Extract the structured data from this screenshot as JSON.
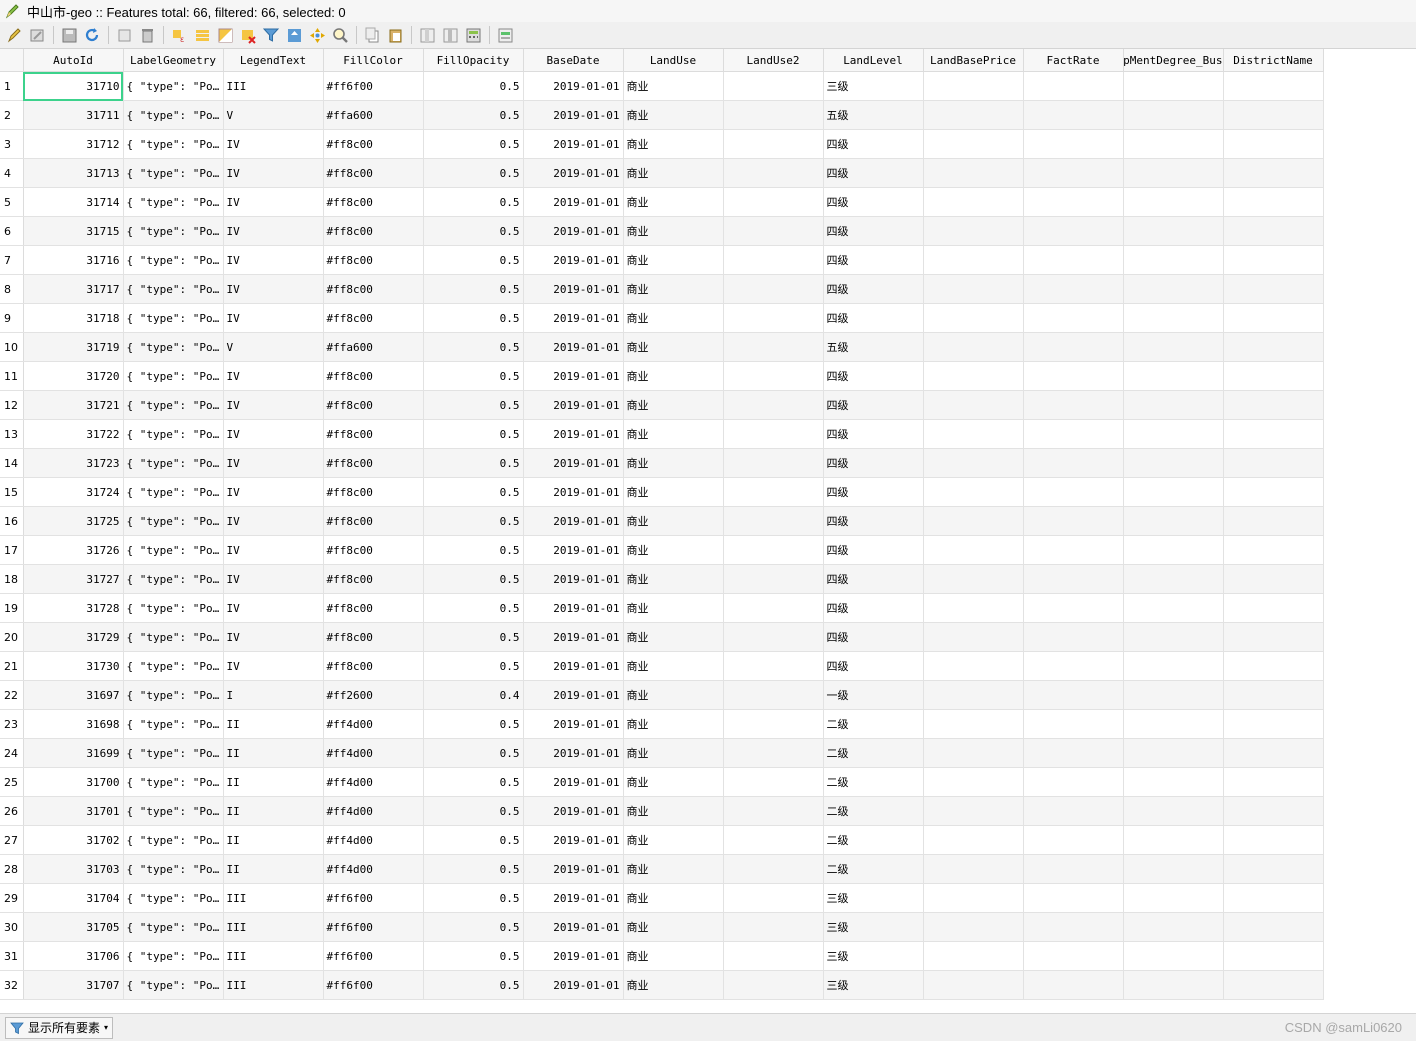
{
  "window": {
    "title": "中山市-geo :: Features total: 66, filtered: 66, selected: 0"
  },
  "toolbar": {
    "buttons": [
      {
        "icon": "toggle-editing-icon"
      },
      {
        "icon": "multi-edit-icon"
      },
      {
        "icon": "save-edits-icon"
      },
      {
        "icon": "reload-icon"
      },
      {
        "icon": "add-feature-icon"
      },
      {
        "icon": "delete-feature-icon"
      },
      {
        "icon": "select-by-expression-icon"
      },
      {
        "icon": "select-all-icon"
      },
      {
        "icon": "invert-selection-icon"
      },
      {
        "icon": "deselect-all-icon"
      },
      {
        "icon": "filter-icon"
      },
      {
        "icon": "move-selection-to-top-icon"
      },
      {
        "icon": "pan-to-selected-icon"
      },
      {
        "icon": "zoom-to-selected-icon"
      },
      {
        "icon": "copy-icon"
      },
      {
        "icon": "paste-icon"
      },
      {
        "icon": "new-field-icon"
      },
      {
        "icon": "delete-field-icon"
      },
      {
        "icon": "field-calculator-icon"
      },
      {
        "icon": "conditional-formatting-icon"
      }
    ]
  },
  "table": {
    "columns": [
      "AutoId",
      "LabelGeometry",
      "LegendText",
      "FillColor",
      "FillOpacity",
      "BaseDate",
      "LandUse",
      "LandUse2",
      "LandLevel",
      "LandBasePrice",
      "FactRate",
      "opMentDegree_Bus",
      "DistrictName"
    ],
    "rows": [
      {
        "n": "1",
        "id": "31710",
        "geom": "{ \"type\": \"Po…",
        "legend": "III",
        "color": "#ff6f00",
        "opacity": "0.5",
        "date": "2019-01-01",
        "use": "商业",
        "use2": "",
        "level": "三级"
      },
      {
        "n": "2",
        "id": "31711",
        "geom": "{ \"type\": \"Po…",
        "legend": "V",
        "color": "#ffa600",
        "opacity": "0.5",
        "date": "2019-01-01",
        "use": "商业",
        "use2": "",
        "level": "五级"
      },
      {
        "n": "3",
        "id": "31712",
        "geom": "{ \"type\": \"Po…",
        "legend": "IV",
        "color": "#ff8c00",
        "opacity": "0.5",
        "date": "2019-01-01",
        "use": "商业",
        "use2": "",
        "level": "四级"
      },
      {
        "n": "4",
        "id": "31713",
        "geom": "{ \"type\": \"Po…",
        "legend": "IV",
        "color": "#ff8c00",
        "opacity": "0.5",
        "date": "2019-01-01",
        "use": "商业",
        "use2": "",
        "level": "四级"
      },
      {
        "n": "5",
        "id": "31714",
        "geom": "{ \"type\": \"Po…",
        "legend": "IV",
        "color": "#ff8c00",
        "opacity": "0.5",
        "date": "2019-01-01",
        "use": "商业",
        "use2": "",
        "level": "四级"
      },
      {
        "n": "6",
        "id": "31715",
        "geom": "{ \"type\": \"Po…",
        "legend": "IV",
        "color": "#ff8c00",
        "opacity": "0.5",
        "date": "2019-01-01",
        "use": "商业",
        "use2": "",
        "level": "四级"
      },
      {
        "n": "7",
        "id": "31716",
        "geom": "{ \"type\": \"Po…",
        "legend": "IV",
        "color": "#ff8c00",
        "opacity": "0.5",
        "date": "2019-01-01",
        "use": "商业",
        "use2": "",
        "level": "四级"
      },
      {
        "n": "8",
        "id": "31717",
        "geom": "{ \"type\": \"Po…",
        "legend": "IV",
        "color": "#ff8c00",
        "opacity": "0.5",
        "date": "2019-01-01",
        "use": "商业",
        "use2": "",
        "level": "四级"
      },
      {
        "n": "9",
        "id": "31718",
        "geom": "{ \"type\": \"Po…",
        "legend": "IV",
        "color": "#ff8c00",
        "opacity": "0.5",
        "date": "2019-01-01",
        "use": "商业",
        "use2": "",
        "level": "四级"
      },
      {
        "n": "10",
        "id": "31719",
        "geom": "{ \"type\": \"Po…",
        "legend": "V",
        "color": "#ffa600",
        "opacity": "0.5",
        "date": "2019-01-01",
        "use": "商业",
        "use2": "",
        "level": "五级"
      },
      {
        "n": "11",
        "id": "31720",
        "geom": "{ \"type\": \"Po…",
        "legend": "IV",
        "color": "#ff8c00",
        "opacity": "0.5",
        "date": "2019-01-01",
        "use": "商业",
        "use2": "",
        "level": "四级"
      },
      {
        "n": "12",
        "id": "31721",
        "geom": "{ \"type\": \"Po…",
        "legend": "IV",
        "color": "#ff8c00",
        "opacity": "0.5",
        "date": "2019-01-01",
        "use": "商业",
        "use2": "",
        "level": "四级"
      },
      {
        "n": "13",
        "id": "31722",
        "geom": "{ \"type\": \"Po…",
        "legend": "IV",
        "color": "#ff8c00",
        "opacity": "0.5",
        "date": "2019-01-01",
        "use": "商业",
        "use2": "",
        "level": "四级"
      },
      {
        "n": "14",
        "id": "31723",
        "geom": "{ \"type\": \"Po…",
        "legend": "IV",
        "color": "#ff8c00",
        "opacity": "0.5",
        "date": "2019-01-01",
        "use": "商业",
        "use2": "",
        "level": "四级"
      },
      {
        "n": "15",
        "id": "31724",
        "geom": "{ \"type\": \"Po…",
        "legend": "IV",
        "color": "#ff8c00",
        "opacity": "0.5",
        "date": "2019-01-01",
        "use": "商业",
        "use2": "",
        "level": "四级"
      },
      {
        "n": "16",
        "id": "31725",
        "geom": "{ \"type\": \"Po…",
        "legend": "IV",
        "color": "#ff8c00",
        "opacity": "0.5",
        "date": "2019-01-01",
        "use": "商业",
        "use2": "",
        "level": "四级"
      },
      {
        "n": "17",
        "id": "31726",
        "geom": "{ \"type\": \"Po…",
        "legend": "IV",
        "color": "#ff8c00",
        "opacity": "0.5",
        "date": "2019-01-01",
        "use": "商业",
        "use2": "",
        "level": "四级"
      },
      {
        "n": "18",
        "id": "31727",
        "geom": "{ \"type\": \"Po…",
        "legend": "IV",
        "color": "#ff8c00",
        "opacity": "0.5",
        "date": "2019-01-01",
        "use": "商业",
        "use2": "",
        "level": "四级"
      },
      {
        "n": "19",
        "id": "31728",
        "geom": "{ \"type\": \"Po…",
        "legend": "IV",
        "color": "#ff8c00",
        "opacity": "0.5",
        "date": "2019-01-01",
        "use": "商业",
        "use2": "",
        "level": "四级"
      },
      {
        "n": "20",
        "id": "31729",
        "geom": "{ \"type\": \"Po…",
        "legend": "IV",
        "color": "#ff8c00",
        "opacity": "0.5",
        "date": "2019-01-01",
        "use": "商业",
        "use2": "",
        "level": "四级"
      },
      {
        "n": "21",
        "id": "31730",
        "geom": "{ \"type\": \"Po…",
        "legend": "IV",
        "color": "#ff8c00",
        "opacity": "0.5",
        "date": "2019-01-01",
        "use": "商业",
        "use2": "",
        "level": "四级"
      },
      {
        "n": "22",
        "id": "31697",
        "geom": "{ \"type\": \"Po…",
        "legend": "I",
        "color": "#ff2600",
        "opacity": "0.4",
        "date": "2019-01-01",
        "use": "商业",
        "use2": "",
        "level": "一级"
      },
      {
        "n": "23",
        "id": "31698",
        "geom": "{ \"type\": \"Po…",
        "legend": "II",
        "color": "#ff4d00",
        "opacity": "0.5",
        "date": "2019-01-01",
        "use": "商业",
        "use2": "",
        "level": "二级"
      },
      {
        "n": "24",
        "id": "31699",
        "geom": "{ \"type\": \"Po…",
        "legend": "II",
        "color": "#ff4d00",
        "opacity": "0.5",
        "date": "2019-01-01",
        "use": "商业",
        "use2": "",
        "level": "二级"
      },
      {
        "n": "25",
        "id": "31700",
        "geom": "{ \"type\": \"Po…",
        "legend": "II",
        "color": "#ff4d00",
        "opacity": "0.5",
        "date": "2019-01-01",
        "use": "商业",
        "use2": "",
        "level": "二级"
      },
      {
        "n": "26",
        "id": "31701",
        "geom": "{ \"type\": \"Po…",
        "legend": "II",
        "color": "#ff4d00",
        "opacity": "0.5",
        "date": "2019-01-01",
        "use": "商业",
        "use2": "",
        "level": "二级"
      },
      {
        "n": "27",
        "id": "31702",
        "geom": "{ \"type\": \"Po…",
        "legend": "II",
        "color": "#ff4d00",
        "opacity": "0.5",
        "date": "2019-01-01",
        "use": "商业",
        "use2": "",
        "level": "二级"
      },
      {
        "n": "28",
        "id": "31703",
        "geom": "{ \"type\": \"Po…",
        "legend": "II",
        "color": "#ff4d00",
        "opacity": "0.5",
        "date": "2019-01-01",
        "use": "商业",
        "use2": "",
        "level": "二级"
      },
      {
        "n": "29",
        "id": "31704",
        "geom": "{ \"type\": \"Po…",
        "legend": "III",
        "color": "#ff6f00",
        "opacity": "0.5",
        "date": "2019-01-01",
        "use": "商业",
        "use2": "",
        "level": "三级"
      },
      {
        "n": "30",
        "id": "31705",
        "geom": "{ \"type\": \"Po…",
        "legend": "III",
        "color": "#ff6f00",
        "opacity": "0.5",
        "date": "2019-01-01",
        "use": "商业",
        "use2": "",
        "level": "三级"
      },
      {
        "n": "31",
        "id": "31706",
        "geom": "{ \"type\": \"Po…",
        "legend": "III",
        "color": "#ff6f00",
        "opacity": "0.5",
        "date": "2019-01-01",
        "use": "商业",
        "use2": "",
        "level": "三级"
      },
      {
        "n": "32",
        "id": "31707",
        "geom": "{ \"type\": \"Po…",
        "legend": "III",
        "color": "#ff6f00",
        "opacity": "0.5",
        "date": "2019-01-01",
        "use": "商业",
        "use2": "",
        "level": "三级"
      }
    ]
  },
  "statusbar": {
    "filter_label": "显示所有要素",
    "watermark": "CSDN @samLi0620"
  },
  "colors": {
    "selection_outline": "#3cd28c",
    "alt_row": "#f5f5f5"
  }
}
